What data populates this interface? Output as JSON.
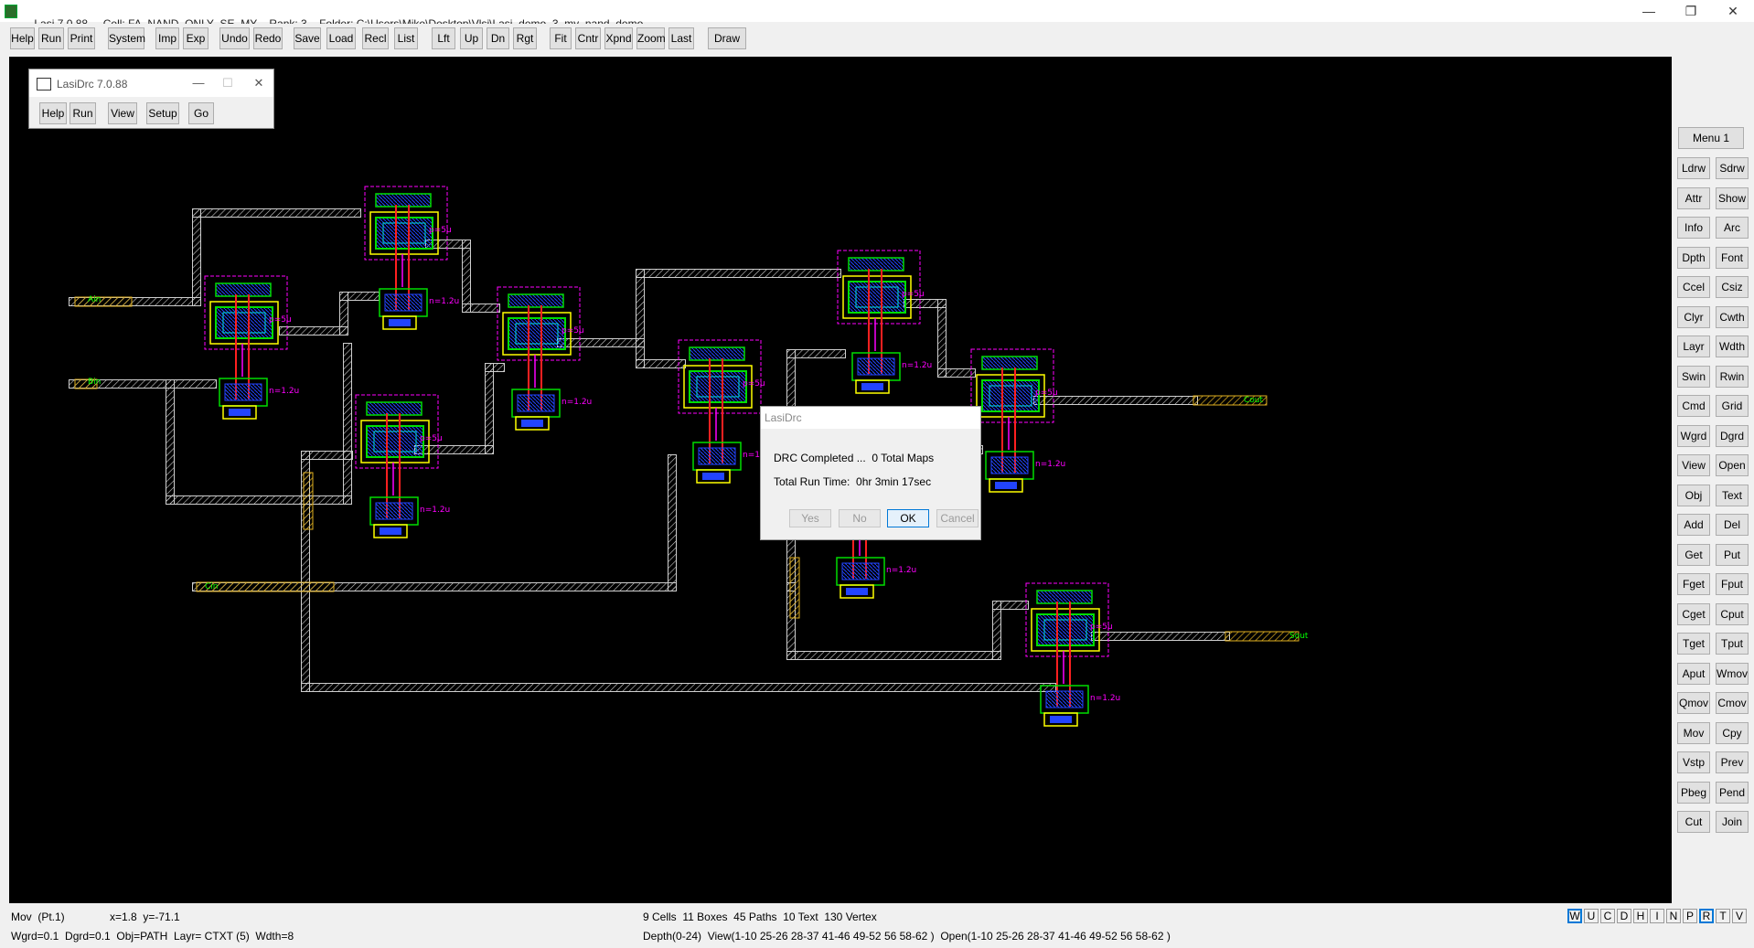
{
  "window": {
    "app_title": "Lasi 7.0.88",
    "cell": "Cell: FA_NAND_ONLY_SE_MY",
    "rank": "Rank: 3",
    "folder": "Folder: C:\\Users\\Mike\\Desktop\\Vlsi\\Lasi_demo_3_my_nand_demo",
    "minimize": "—",
    "restore": "❐",
    "close": "✕"
  },
  "toolbar": {
    "buttons": [
      "Help",
      "Run",
      "Print",
      "System",
      "Imp",
      "Exp",
      "Undo",
      "Redo",
      "Save",
      "Load",
      "Recl",
      "List",
      "Lft",
      "Up",
      "Dn",
      "Rgt",
      "Fit",
      "Cntr",
      "Xpnd",
      "Zoom",
      "Last",
      "Draw"
    ]
  },
  "drc_window": {
    "title": "LasiDrc 7.0.88",
    "buttons": [
      "Help",
      "Run",
      "View",
      "Setup",
      "Go"
    ],
    "minimize": "—",
    "maximize": "☐",
    "close": "✕"
  },
  "dialog": {
    "title": "LasiDrc",
    "message": "DRC Completed ...  0 Total Maps",
    "runtime": "Total Run Time:  0hr 3min 17sec",
    "buttons": [
      {
        "label": "Yes",
        "enabled": false
      },
      {
        "label": "No",
        "enabled": false
      },
      {
        "label": "OK",
        "enabled": true
      },
      {
        "label": "Cancel",
        "enabled": false
      }
    ]
  },
  "right_panel": {
    "menu_label": "Menu 1",
    "buttons": [
      [
        "Ldrw",
        "Sdrw"
      ],
      [
        "Attr",
        "Show"
      ],
      [
        "Info",
        "Arc"
      ],
      [
        "Dpth",
        "Font"
      ],
      [
        "Ccel",
        "Csiz"
      ],
      [
        "Clyr",
        "Cwth"
      ],
      [
        "Layr",
        "Wdth"
      ],
      [
        "Swin",
        "Rwin"
      ],
      [
        "Cmd",
        "Grid"
      ],
      [
        "Wgrd",
        "Dgrd"
      ],
      [
        "View",
        "Open"
      ],
      [
        "Obj",
        "Text"
      ],
      [
        "Add",
        "Del"
      ],
      [
        "Get",
        "Put"
      ],
      [
        "Fget",
        "Fput"
      ],
      [
        "Cget",
        "Cput"
      ],
      [
        "Tget",
        "Tput"
      ],
      [
        "Aput",
        "Wmov"
      ],
      [
        "Qmov",
        "Cmov"
      ],
      [
        "Mov",
        "Cpy"
      ],
      [
        "Vstp",
        "Prev"
      ],
      [
        "Pbeg",
        "Pend"
      ],
      [
        "Cut",
        "Join"
      ]
    ]
  },
  "status": {
    "mode": "Mov  (Pt.1)",
    "coords": "x=1.8  y=-71.1",
    "summary": "9 Cells  11 Boxes  45 Paths  10 Text  130 Vertex",
    "grid_info": "Wgrd=0.1  Dgrd=0.1  Obj=PATH  Layr= CTXT (5)  Wdth=8",
    "depth_info": "Depth(0-24)  View(1-10 25-26 28-37 41-46 49-52 56 58-62 )  Open(1-10 25-26 28-37 41-46 49-52 56 58-62 )",
    "letters": [
      "W",
      "U",
      "C",
      "D",
      "H",
      "I",
      "N",
      "P",
      "R",
      "T",
      "V"
    ],
    "active_letters": [
      "W",
      "R"
    ]
  },
  "layout_canvas": {
    "pin_labels": [
      "Cin",
      "Ain",
      "Bin",
      "Cout",
      "Sout"
    ],
    "cell_label_1": "p=5u",
    "cell_label_2": "n=1.2u",
    "colors": {
      "wire": "#cfcfcf",
      "pin": "#e0b020",
      "pin_text": "#00ff00",
      "green": "#00dd00",
      "blue": "#2244ff",
      "magenta": "#ff00ff",
      "red": "#ff2020",
      "yellow": "#ffff00",
      "cyan": "#00e0e0"
    }
  }
}
